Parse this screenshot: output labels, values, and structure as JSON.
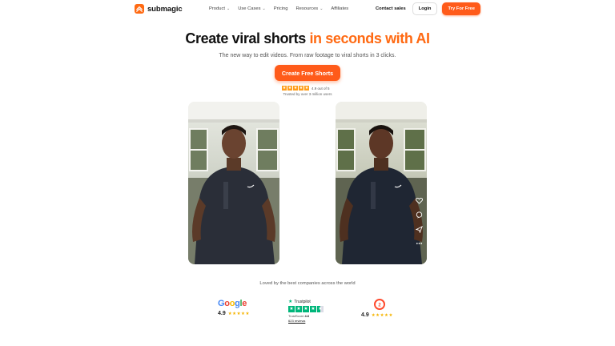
{
  "nav": {
    "logo_text": "submagic",
    "menu": [
      {
        "label": "Product",
        "has_dropdown": true
      },
      {
        "label": "Use Cases",
        "has_dropdown": true
      },
      {
        "label": "Pricing",
        "has_dropdown": false
      },
      {
        "label": "Resources",
        "has_dropdown": true
      },
      {
        "label": "Affiliates",
        "has_dropdown": false
      }
    ],
    "contact_label": "Contact sales",
    "login_label": "Login",
    "try_label": "Try For Free"
  },
  "hero": {
    "headline_part1": "Create viral shorts ",
    "headline_accent": "in seconds with AI",
    "subheadline": "The new way to edit videos. From raw footage to viral shorts in 3 clicks.",
    "cta_label": "Create Free Shorts",
    "rating_text": "4.9 out of 5",
    "trusted_text": "Trusted by over 3 million users",
    "rating_stars": 5
  },
  "videos": {
    "left_label": "raw footage preview",
    "right_label": "edited short preview",
    "right_overlay_icons": [
      "heart-icon",
      "comment-icon",
      "share-icon",
      "more-icon"
    ]
  },
  "trust": {
    "heading": "Loved by the best companies across the world",
    "google": {
      "name": "Google",
      "score": "4.9"
    },
    "trustpilot": {
      "name": "Trustpilot",
      "line1_label": "TrustScore",
      "line1_value": "4.6",
      "reviews": "623 reviews"
    },
    "g2": {
      "name": "G2",
      "score": "4.9"
    }
  },
  "colors": {
    "accent": "#ff6a13",
    "button": "#ff5b1a",
    "trustpilot_green": "#00b67a",
    "star_yellow": "#f5b400"
  }
}
